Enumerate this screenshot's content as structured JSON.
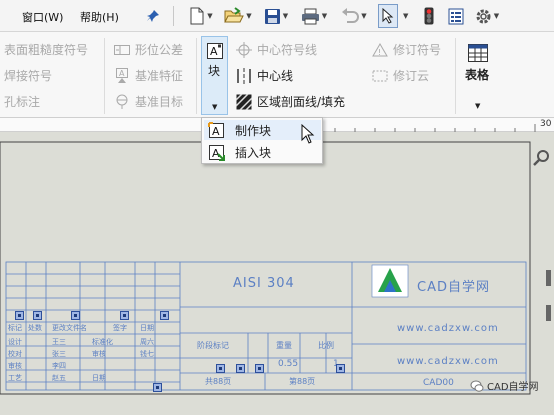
{
  "menu": {
    "items": [
      "窗口(W)",
      "帮助(H)"
    ]
  },
  "toolbar": {
    "icons": [
      "pin-icon",
      "new-file-icon",
      "open-folder-icon",
      "save-icon",
      "print-icon",
      "undo-icon",
      "select-icon",
      "traffic-light-icon",
      "options-icon",
      "gear-icon"
    ]
  },
  "ribbon": {
    "annotation_left": {
      "surface_finish": "表面粗糙度符号",
      "weld_symbol": "焊接符号",
      "hole_callout": "孔标注"
    },
    "annotation_mid": {
      "geometric_tolerance": "形位公差",
      "datum_feature": "基准特征",
      "datum_target": "基准目标"
    },
    "block": {
      "label": "块"
    },
    "annotation_right": {
      "center_mark": "中心符号线",
      "centerline": "中心线",
      "area_hatch": "区域剖面线/填充"
    },
    "revision": {
      "revision_symbol": "修订符号",
      "revision_cloud": "修订云"
    },
    "table": {
      "label": "表格"
    }
  },
  "dropdown": {
    "make_block": "制作块",
    "insert_block": "插入块"
  },
  "ruler": {
    "value": "30"
  },
  "title_block": {
    "material": "AISI 304",
    "logo_text": "CAD自学网",
    "url1": "www.cadzxw.com",
    "url2": "www.cadzxw.com",
    "code": "CAD00",
    "row_labels": [
      "标记",
      "处数",
      "更改文件名",
      "签字",
      "日期"
    ],
    "design_row": [
      "设计",
      "王三",
      "标准化",
      "周六"
    ],
    "check_row": [
      "校对",
      "张三",
      "审核",
      "钱七"
    ],
    "process_row": [
      "审核",
      "李四"
    ],
    "craft_row": [
      "工艺",
      "赵五",
      "日期"
    ],
    "stage_header": [
      "阶段标记",
      "重量",
      "比例"
    ],
    "weight": "0.55",
    "scale": "1",
    "sheets": "共88页",
    "sheet_no": "第88页"
  },
  "watermark": {
    "text": "CAD自学网"
  },
  "colors": {
    "accent": "#5c80c4",
    "grip": "#9fb6e4",
    "canvas": "#dcddd6",
    "hover": "#e4eefa"
  }
}
